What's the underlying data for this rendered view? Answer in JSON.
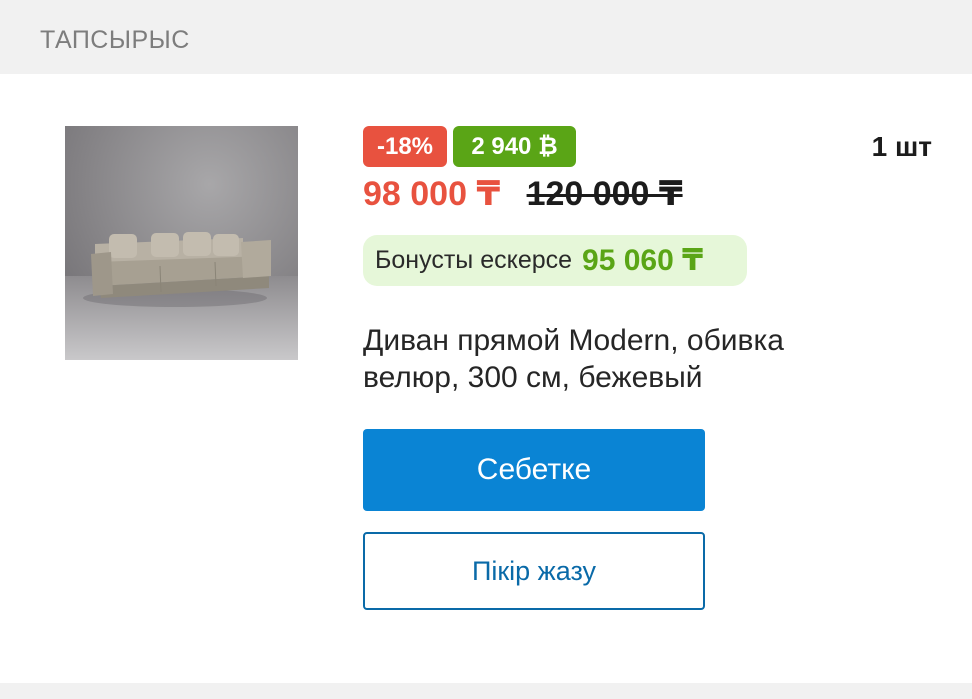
{
  "header": {
    "title": "ТАПСЫРЫС"
  },
  "product": {
    "image_alt": "sofa-photo",
    "discount_badge": "-18%",
    "bonus_badge": "2 940 ₿",
    "quantity": "1 шт",
    "price_current": "98 000 ₸",
    "price_old": "120 000 ₸",
    "bonus_label": "Бонусты ескерсе",
    "bonus_value": "95 060 ₸",
    "name": "Диван прямой Modern, обивка велюр, 300 см, бежевый"
  },
  "actions": {
    "add_to_cart": "Себетке",
    "write_review": "Пікір жазу"
  },
  "colors": {
    "discount": "#e8523f",
    "bonus": "#5aa516",
    "primary_button": "#0a84d4",
    "secondary_border": "#0a6aa8"
  }
}
